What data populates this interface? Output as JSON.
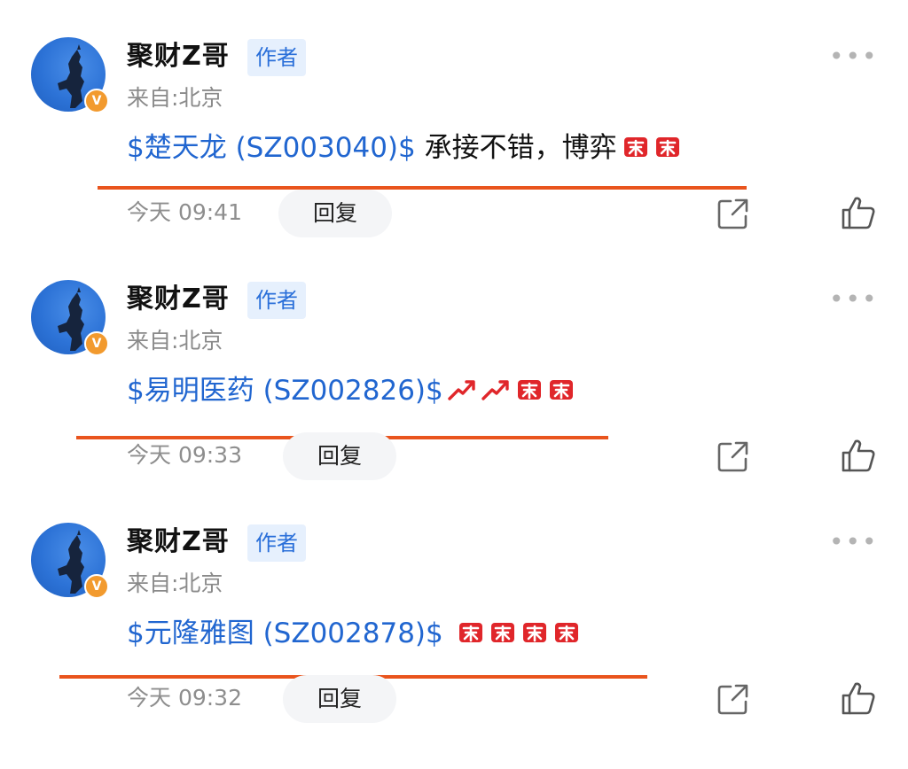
{
  "posts": [
    {
      "username": "聚财Z哥",
      "badge": "作者",
      "location": "来自:北京",
      "stock": "$楚天龙 (SZ003040)$",
      "text": " 承接不错，博弈",
      "emoji": [
        "buy-emoji",
        "buy-emoji"
      ],
      "time": "今天 09:41",
      "reply_label": "回复",
      "verified_badge": "V"
    },
    {
      "username": "聚财Z哥",
      "badge": "作者",
      "location": "来自:北京",
      "stock": "$易明医药 (SZ002826)$",
      "text": "",
      "emoji": [
        "trend-up-emoji",
        "trend-up-emoji",
        "buy-emoji",
        "buy-emoji"
      ],
      "time": "今天 09:33",
      "reply_label": "回复",
      "verified_badge": "V"
    },
    {
      "username": "聚财Z哥",
      "badge": "作者",
      "location": "来自:北京",
      "stock": "$元隆雅图 (SZ002878)$",
      "text": " ",
      "emoji": [
        "buy-emoji",
        "buy-emoji",
        "buy-emoji",
        "buy-emoji"
      ],
      "time": "今天 09:32",
      "reply_label": "回复",
      "verified_badge": "V"
    }
  ],
  "colors": {
    "link": "#2166d0",
    "underline": "#e9541d",
    "badge_bg": "#e6f0fd",
    "verified": "#f29a2e"
  },
  "icons": {
    "more": "more-dots-icon",
    "share": "share-icon",
    "like": "thumbs-up-icon"
  }
}
